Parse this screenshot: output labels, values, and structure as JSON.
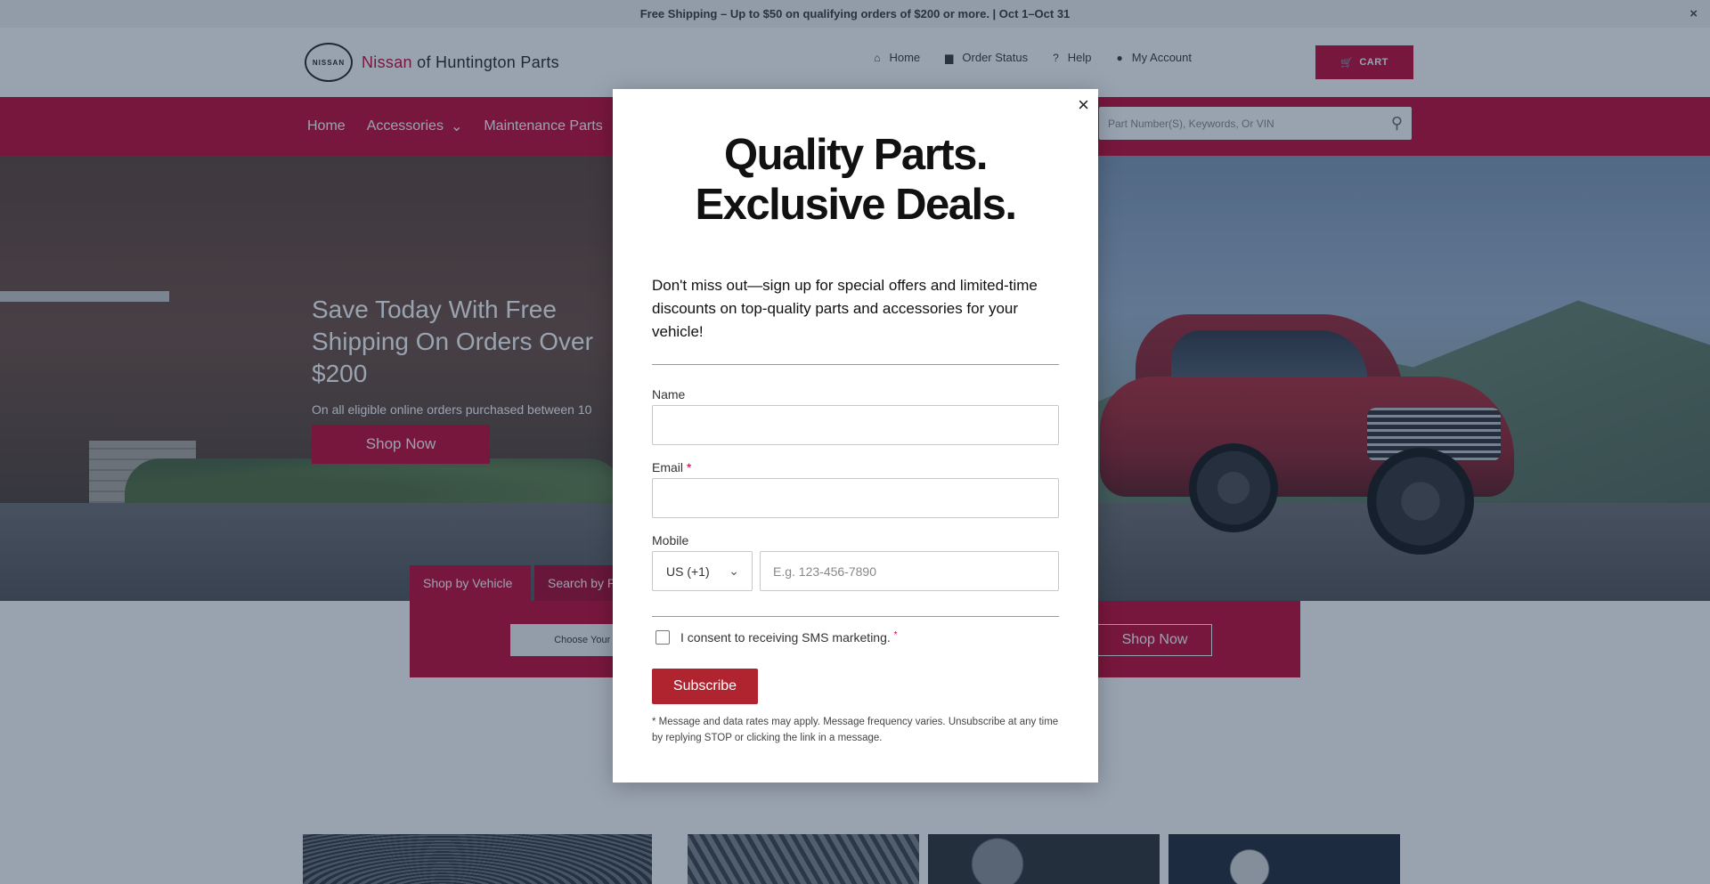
{
  "announcement": {
    "text": "Free Shipping – Up to $50 on qualifying orders of $200 or more. | Oct 1–Oct 31",
    "close_icon": "×"
  },
  "header": {
    "logo_mark": "NISSAN",
    "logo_brand": "Nissan",
    "logo_rest": " of Huntington Parts",
    "links": [
      {
        "icon": "home-icon",
        "glyph": "⌂",
        "label": "Home"
      },
      {
        "icon": "truck-icon",
        "glyph": "▆",
        "label": "Order Status"
      },
      {
        "icon": "question-icon",
        "glyph": "?",
        "label": "Help"
      },
      {
        "icon": "user-icon",
        "glyph": "●",
        "label": "My Account"
      }
    ],
    "cart_label": "CART",
    "cart_glyph": "🛒"
  },
  "nav": {
    "items": [
      {
        "label": "Home"
      },
      {
        "label": "Accessories",
        "chevron": "⌄"
      },
      {
        "label": "Maintenance Parts"
      }
    ],
    "search_placeholder": "Part Number(S), Keywords, Or VIN",
    "search_glyph": "⚲"
  },
  "hero": {
    "title": "Save Today With Free Shipping On Orders Over $200",
    "subtitle": "On all eligible online orders purchased between 10",
    "button": "Shop Now"
  },
  "finder": {
    "tabs": [
      "Shop by Vehicle",
      "Search by Part"
    ],
    "select_label": "Choose Your Vehicle",
    "button": "Shop Now"
  },
  "modal": {
    "close_glyph": "×",
    "heading_line1": "Quality Parts.",
    "heading_line2": "Exclusive Deals.",
    "description": "Don't miss out—sign up for special offers and limited-time discounts on top-quality parts and accessories for your vehicle!",
    "name_label": "Name",
    "email_label": "Email",
    "required_mark": "*",
    "mobile_label": "Mobile",
    "country_value": "US (+1)",
    "country_chevron": "⌄",
    "phone_placeholder": "E.g. 123-456-7890",
    "consent_text": "I consent to receiving SMS marketing.",
    "consent_checked": false,
    "subscribe_label": "Subscribe",
    "disclaimer": "* Message and data rates may apply. Message frequency varies. Unsubscribe at any time by replying STOP or clicking the link in a message."
  },
  "colors": {
    "brand_red": "#c3002f",
    "subscribe_red": "#b02430",
    "overlay": "rgba(28,52,79,0.45)"
  }
}
